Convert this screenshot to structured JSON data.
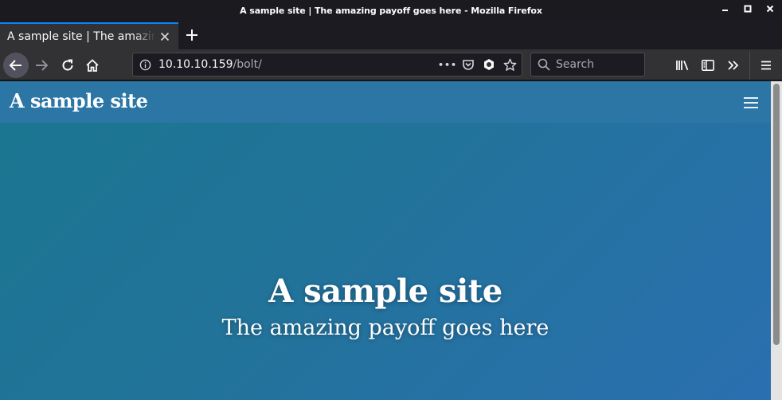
{
  "window": {
    "title": "A sample site | The amazing payoff goes here - Mozilla Firefox",
    "controls": {
      "minimize": "▁",
      "maximize": "□",
      "close": "✕"
    }
  },
  "tabs": [
    {
      "title": "A sample site | The amazing payoff goes here",
      "active": true
    }
  ],
  "tab_actions": {
    "close_glyph": "✕",
    "new_tab_glyph": "+"
  },
  "nav": {
    "icons": [
      "back-arrow-icon",
      "forward-arrow-icon",
      "reload-icon",
      "home-icon"
    ]
  },
  "urlbar": {
    "host": "10.10.10.159",
    "path": "/bolt/",
    "page_actions_glyph": "•••"
  },
  "search": {
    "placeholder": "Search"
  },
  "toolbar": {
    "icons": [
      "library-icon",
      "sidebar-icon",
      "overflow-chevron-icon",
      "hamburger-menu-icon"
    ]
  },
  "site": {
    "brand": "A sample site",
    "hero_title": "A sample site",
    "hero_subtitle": "The amazing payoff goes here"
  },
  "colors": {
    "accent": "#0a84ff",
    "site_header": "#2c76a6",
    "hero_gradient_start": "#1a7690",
    "hero_gradient_end": "#2a6fb0"
  }
}
